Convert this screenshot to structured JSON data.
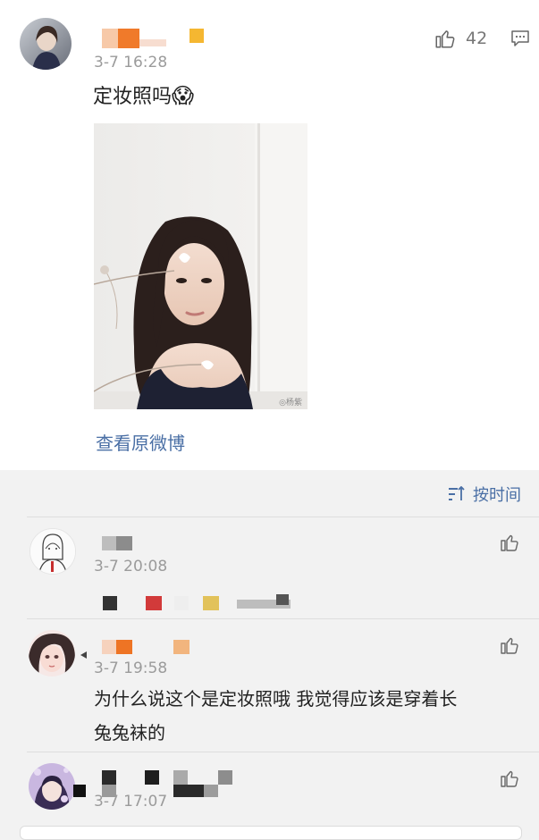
{
  "post": {
    "like_count": "42",
    "timestamp": "3-7 16:28",
    "text": "定妆照吗",
    "emoji": "😱",
    "photo_watermark": "◎杨紫",
    "view_original_label": "查看原微博"
  },
  "sort": {
    "label": "按时间"
  },
  "comments": [
    {
      "timestamp": "3-7 20:08"
    },
    {
      "timestamp": "3-7 19:58",
      "text_line1": "为什么说这个是定妆照哦 我觉得应该是穿着长",
      "text_line2": "兔兔袜的"
    },
    {
      "timestamp": "3-7 17:07"
    }
  ]
}
